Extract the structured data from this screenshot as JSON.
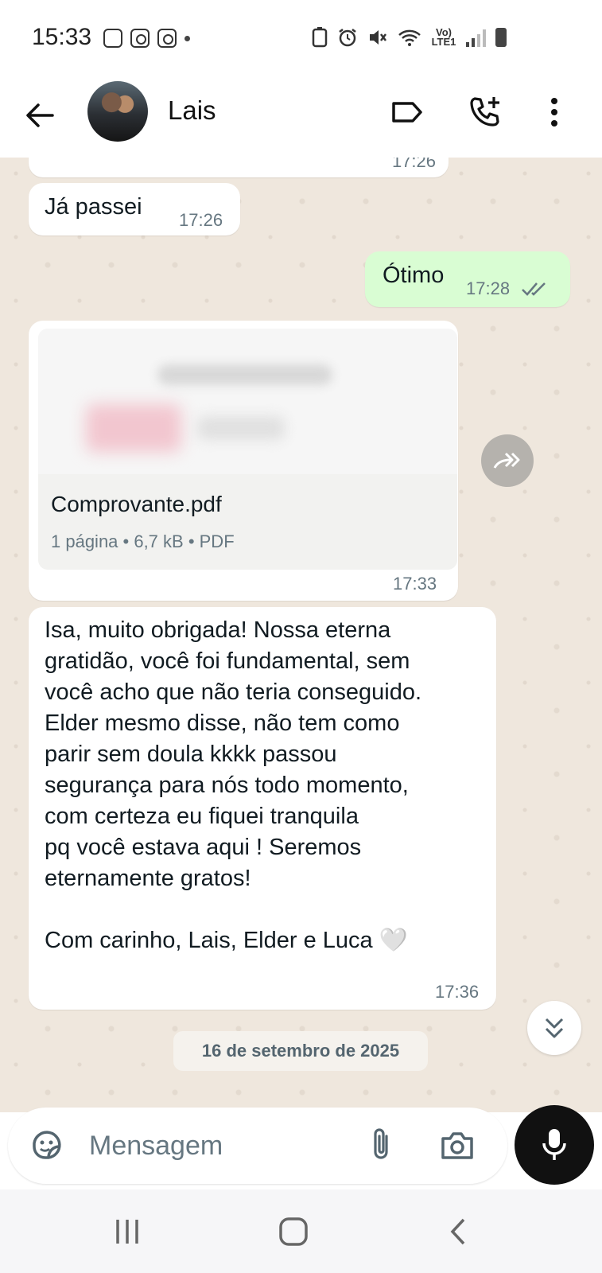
{
  "status_bar": {
    "time": "15:33",
    "network": "Vo) LTE1"
  },
  "header": {
    "contact_name": "Lais"
  },
  "messages": [
    {
      "text": "",
      "time": "17:26",
      "direction": "in"
    },
    {
      "text": "Já passei",
      "time": "17:26",
      "direction": "in"
    },
    {
      "text": "Ótimo",
      "time": "17:28",
      "direction": "out"
    },
    {
      "text": "",
      "time": "17:33",
      "direction": "in"
    },
    {
      "text": "Isa, muito obrigada! Nossa eterna\ngratidão, você foi fundamental, sem\nvocê acho que não teria conseguido.\nElder mesmo disse, não tem como\nparir sem doula kkkk passou\nsegurança para nós todo momento,\ncom certeza eu fiquei tranquila\npq você estava aqui ! Seremos\neternamente gratos!\n\nCom carinho, Lais, Elder e Luca 🤍",
      "time": "17:36",
      "direction": "in"
    }
  ],
  "document": {
    "name": "Comprovante.pdf",
    "meta": "1 página • 6,7 kB • PDF"
  },
  "date_separator": "16 de setembro de 2025",
  "composer": {
    "placeholder": "Mensagem"
  },
  "icons": {
    "back": "arrow-left-icon",
    "label": "label-icon",
    "call": "add-call-icon",
    "menu": "more-vert-icon",
    "forward": "forward-icon",
    "scroll": "double-chevron-down-icon",
    "sticker": "sticker-icon",
    "attach": "paperclip-icon",
    "camera": "camera-icon",
    "mic": "microphone-icon",
    "read": "double-check-icon"
  }
}
